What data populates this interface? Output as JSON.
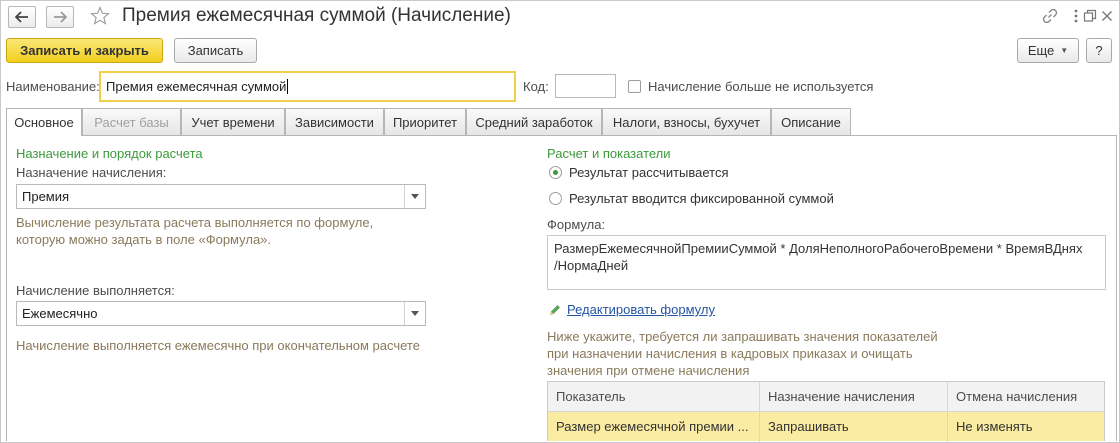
{
  "window": {
    "title": "Премия ежемесячная суммой (Начисление)",
    "back_icon": "arrow-left-icon",
    "forward_icon": "arrow-right-icon",
    "favorite_icon": "star-icon",
    "link_icon": "link-icon",
    "menu_icon": "more-vertical-icon",
    "maximize_icon": "restore-icon",
    "close_icon": "close-icon"
  },
  "toolbar": {
    "save_close_label": "Записать и закрыть",
    "save_label": "Записать",
    "more_label": "Еще",
    "help_label": "?"
  },
  "header": {
    "name_label": "Наименование:",
    "name_value": "Премия ежемесячная суммой",
    "code_label": "Код:",
    "code_value": "",
    "not_used_label": "Начисление больше не используется",
    "not_used_checked": false
  },
  "tabs": [
    {
      "label": "Основное",
      "active": true
    },
    {
      "label": "Расчет базы",
      "disabled": true
    },
    {
      "label": "Учет времени"
    },
    {
      "label": "Зависимости"
    },
    {
      "label": "Приоритет"
    },
    {
      "label": "Средний заработок"
    },
    {
      "label": "Налоги, взносы, бухучет"
    },
    {
      "label": "Описание"
    }
  ],
  "left": {
    "section_title": "Назначение и порядок расчета",
    "purpose_label": "Назначение начисления:",
    "purpose_value": "Премия",
    "purpose_hint_line1": "Вычисление результата расчета выполняется по формуле,",
    "purpose_hint_line2": "которую можно задать в поле «Формула».",
    "execution_label": "Начисление выполняется:",
    "execution_value": "Ежемесячно",
    "execution_hint": "Начисление выполняется ежемесячно при окончательном расчете"
  },
  "right": {
    "section_title": "Расчет и показатели",
    "radio_calculated": "Результат рассчитывается",
    "radio_fixed": "Результат вводится фиксированной суммой",
    "selected": "calculated",
    "formula_label": "Формула:",
    "formula_line1": "РазмерЕжемесячнойПремииСуммой * ДоляНеполногоРабочегоВремени * ВремяВДнях",
    "formula_line2": "/НормаДней",
    "edit_formula_link": "Редактировать формулу",
    "edit_icon": "pencil-icon",
    "note_line1": "Ниже укажите, требуется ли запрашивать значения показателей",
    "note_line2": "при назначении начисления в кадровых приказах и очищать",
    "note_line3": "значения при отмене начисления"
  },
  "table": {
    "columns": [
      "Показатель",
      "Назначение начисления",
      "Отмена начисления"
    ],
    "rows": [
      [
        "Размер ежемесячной премии ...",
        "Запрашивать",
        "Не изменять"
      ]
    ]
  },
  "colors": {
    "accent_yellow": "#f2cf1c",
    "group_title_green": "#3c9a3c",
    "hint_text": "#8a7a5c",
    "link_blue": "#2554a3",
    "selected_row": "#fbeca3"
  }
}
